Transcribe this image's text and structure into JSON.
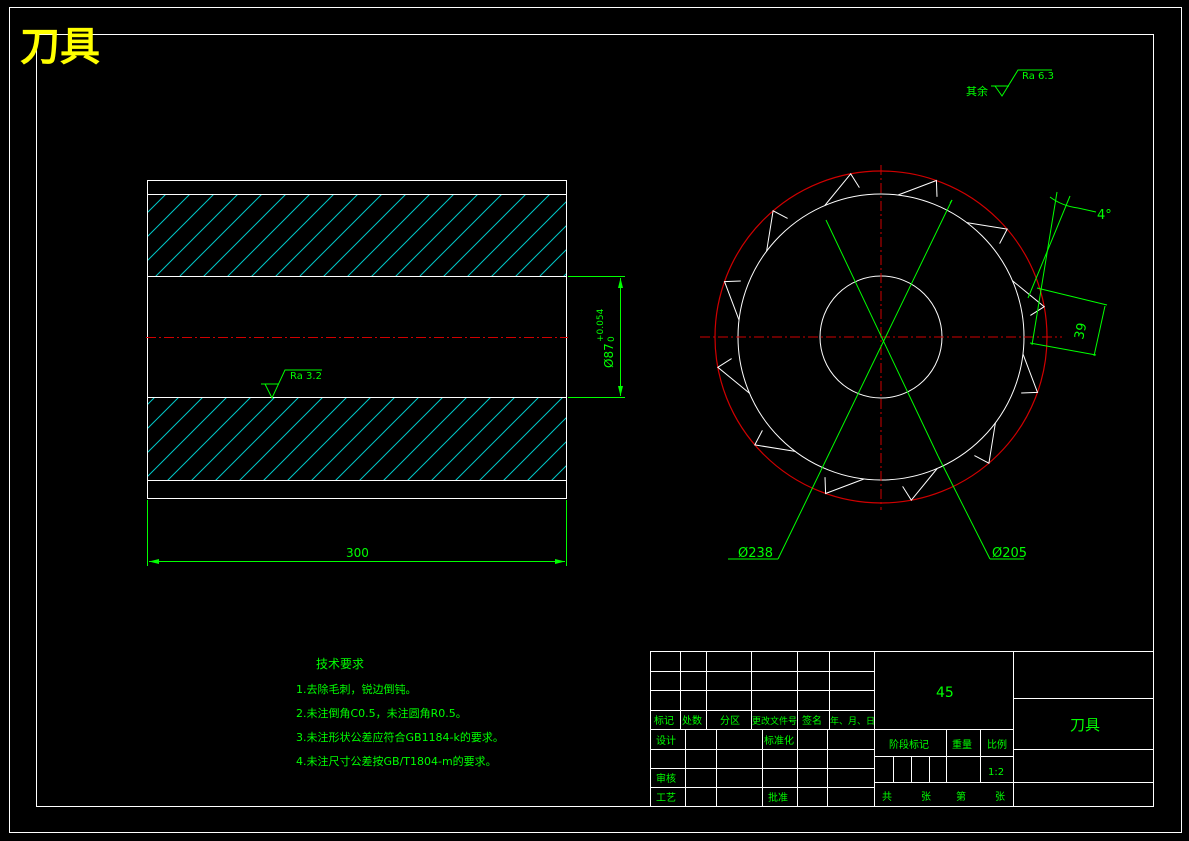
{
  "title": "刀具",
  "roughness_general": {
    "prefix": "其余",
    "value": "Ra 6.3"
  },
  "left_view": {
    "bore_roughness": "Ra 3.2",
    "length_dim": "300",
    "bore_dim": "Ø87",
    "bore_tol_upper": "+0.054",
    "bore_tol_lower": "0"
  },
  "right_view": {
    "outer_dim": "Ø238",
    "root_dim": "Ø205",
    "angle_dim": "4°",
    "pitch_dim": "39"
  },
  "tech_requirements": {
    "heading": "技术要求",
    "items": [
      "1.去除毛刺，锐边倒钝。",
      "2.未注倒角C0.5，未注圆角R0.5。",
      "3.未注形状公差应符合GB1184-k的要求。",
      "4.未注尺寸公差按GB/T1804-m的要求。"
    ]
  },
  "title_block": {
    "material": "45",
    "part_name": "刀具",
    "hdr_mark": "标记",
    "hdr_count": "处数",
    "hdr_zone": "分区",
    "hdr_docno": "更改文件号",
    "hdr_sign": "签名",
    "hdr_date": "年、月、日",
    "design": "设计",
    "standardize": "标准化",
    "review": "审核",
    "process": "工艺",
    "approve": "批准",
    "stage_mark": "阶段标记",
    "weight": "重量",
    "scale_label": "比例",
    "scale": "1:2",
    "total": "共",
    "sheets": "张",
    "no": "第",
    "sheet": "张"
  }
}
